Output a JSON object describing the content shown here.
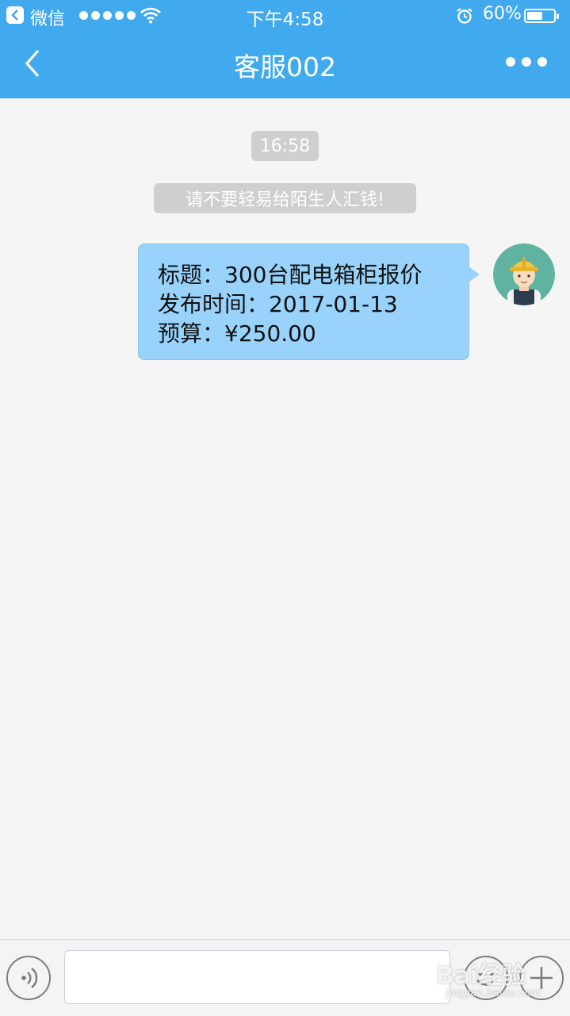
{
  "status_bar": {
    "back_app": "微信",
    "time": "下午4:58",
    "battery_percent": "60%",
    "battery_level": 0.6,
    "icons": [
      "back-arrow-icon",
      "signal-dots-icon",
      "wifi-icon",
      "alarm-icon",
      "battery-icon"
    ]
  },
  "nav": {
    "title": "客服002",
    "icons": [
      "chevron-left-icon",
      "more-dots-icon"
    ]
  },
  "chat": {
    "timestamp": "16:58",
    "system_notice": "请不要轻易给陌生人汇钱!",
    "message": {
      "line1": "标题：300台配电箱柜报价",
      "line2": "发布时间：2017-01-13",
      "line3": "预算：¥250.00"
    }
  },
  "input_bar": {
    "icons": [
      "voice-icon",
      "emoji-icon",
      "plus-icon"
    ]
  },
  "watermark": {
    "brand": "Bai经验",
    "url": "jingyan.baidu.com"
  },
  "colors": {
    "header": "#41a9ee",
    "bubble": "#99d2fb",
    "background": "#f5f5f5"
  }
}
